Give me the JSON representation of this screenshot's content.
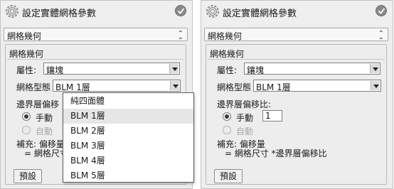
{
  "left": {
    "title": "設定實體網格參數",
    "section_header": "網格幾何",
    "group_title": "網格幾何",
    "attribute_label": "屬性:",
    "attribute_value": "鑲塊",
    "mesh_type_label": "網格型態",
    "mesh_type_value": "BLM 1層",
    "boundary_ratio_label": "邊界層偏移",
    "manual_label": "手動",
    "auto_label": "自動",
    "supplement_label": "補充: 偏移量",
    "formula": "= 網格尺寸",
    "default_button": "預設"
  },
  "dropdown": {
    "options": [
      "純四面體",
      "BLM 1層",
      "BLM 2層",
      "BLM 3層",
      "BLM 4層",
      "BLM 5層"
    ],
    "selected_index": 1
  },
  "right": {
    "title": "設定實體網格參數",
    "section_header": "網格幾何",
    "group_title": "網格幾何",
    "attribute_label": "屬性:",
    "attribute_value": "鑲塊",
    "mesh_type_label": "網格型態",
    "mesh_type_value": "BLM 1層",
    "boundary_ratio_label": "邊界層偏移比:",
    "manual_label": "手動",
    "manual_value": "1",
    "auto_label": "自動",
    "supplement_label": "補充: 偏移量",
    "formula": "= 網格尺寸 *邊界層偏移比",
    "default_button": "預設"
  },
  "icons": {
    "title": "gear-icon",
    "confirm": "check-icon",
    "collapse": "double-chevron-up-icon",
    "dropdown": "chevron-down-icon"
  },
  "colors": {
    "panel_bg": "#ededed",
    "check_circle": "#8a8a8a",
    "selected_item": "#e6e6e6"
  }
}
